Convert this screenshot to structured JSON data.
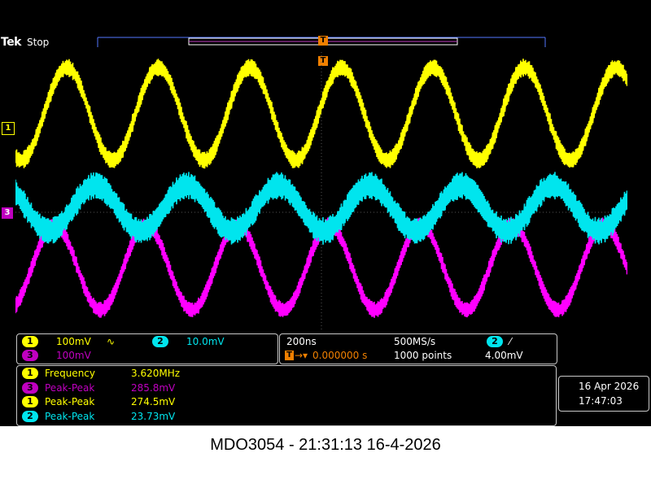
{
  "header": {
    "brand": "Tek",
    "run_state": "Stop",
    "trigger_marker": "T"
  },
  "channels": {
    "ch1": {
      "number": "1",
      "color": "#ffff00"
    },
    "ch2": {
      "number": "2",
      "color": "#00e5ee"
    },
    "ch3": {
      "number": "3",
      "color": "#ff00ff"
    }
  },
  "vertical": {
    "ch1_scale": "100mV",
    "ch1_coupling_symbol": "∿",
    "ch2_scale": "10.0mV",
    "ch3_scale": "100mV"
  },
  "horizontal": {
    "time_per_div": "200ns",
    "sample_rate": "500MS/s",
    "trigger_label": "T",
    "trigger_position": "0.000000 s",
    "record_length": "1000 points",
    "trigger_channel": "2",
    "trigger_slope": "⁄",
    "trigger_level": "4.00mV"
  },
  "measurements": [
    {
      "channel": "1",
      "label": "Frequency",
      "value": "3.620MHz"
    },
    {
      "channel": "3",
      "label": "Peak-Peak",
      "value": "285.8mV"
    },
    {
      "channel": "1",
      "label": "Peak-Peak",
      "value": "274.5mV"
    },
    {
      "channel": "2",
      "label": "Peak-Peak",
      "value": "23.73mV"
    }
  ],
  "datetime": {
    "date": "16 Apr  2026",
    "time": "17:47:03"
  },
  "caption": "MDO3054 - 21:31:13    16-4-2026"
}
